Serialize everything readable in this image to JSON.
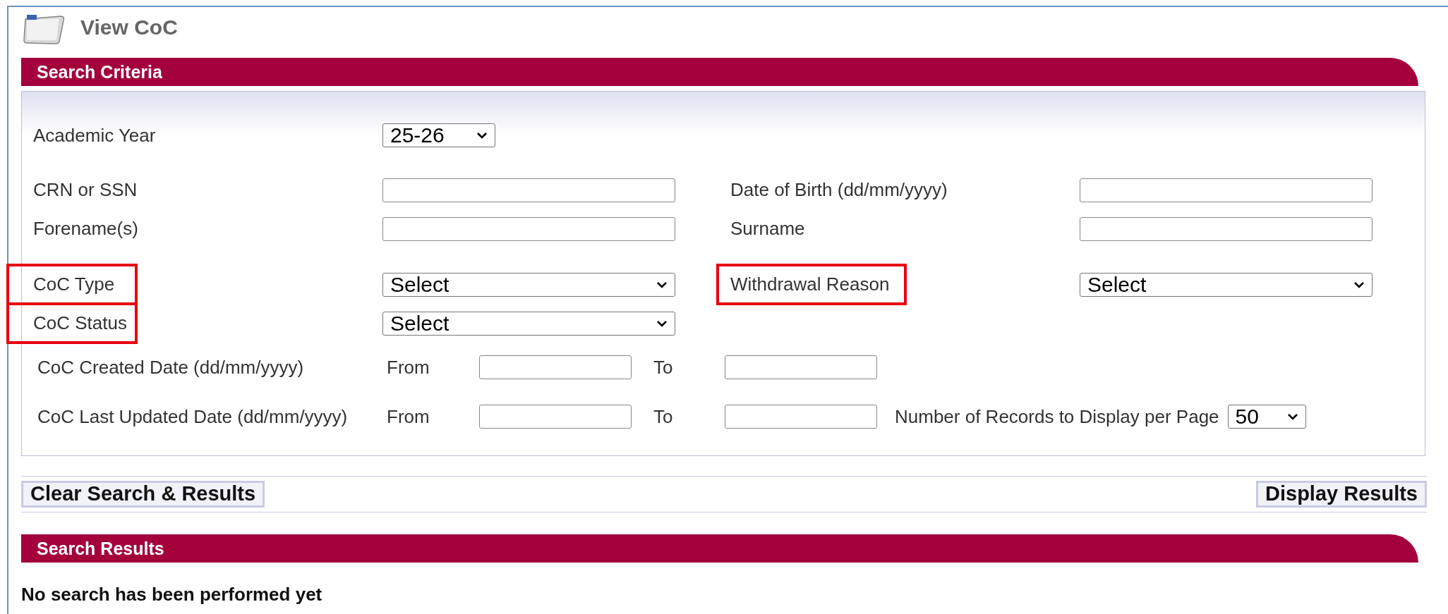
{
  "page": {
    "title": "View CoC"
  },
  "search_criteria": {
    "title": "Search Criteria",
    "rows": [
      {
        "fields": [
          {
            "kind": "short-select",
            "label": "Academic Year",
            "value": "25-26",
            "highlighted": false
          }
        ]
      },
      {
        "fields": [
          {
            "kind": "text",
            "label": "CRN or SSN",
            "highlighted": false
          },
          {
            "kind": "text",
            "label": "Date of Birth (dd/mm/yyyy)",
            "highlighted": false
          }
        ]
      },
      {
        "fields": [
          {
            "kind": "text",
            "label": "Forename(s)",
            "highlighted": false
          },
          {
            "kind": "text",
            "label": "Surname",
            "highlighted": false
          }
        ]
      },
      {
        "fields": [
          {
            "kind": "select",
            "label": "CoC Type",
            "value": "Select",
            "highlighted": true
          },
          {
            "kind": "select",
            "label": "Withdrawal Reason",
            "value": "Select",
            "highlighted": true
          }
        ]
      },
      {
        "fields": [
          {
            "kind": "select",
            "label": "CoC Status",
            "value": "Select",
            "highlighted": true
          }
        ]
      }
    ],
    "date_ranges": [
      {
        "label": "CoC Created Date (dd/mm/yyyy)",
        "from_label": "From",
        "to_label": "To"
      },
      {
        "label": "CoC Last Updated Date (dd/mm/yyyy)",
        "from_label": "From",
        "to_label": "To",
        "records": {
          "label": "Number of Records to Display per Page",
          "value": "50"
        }
      }
    ]
  },
  "buttons": [
    {
      "label": "Clear Search & Results"
    },
    {
      "label": "Display Results"
    }
  ],
  "search_results": {
    "title": "Search Results",
    "message": "No search has been performed yet"
  }
}
